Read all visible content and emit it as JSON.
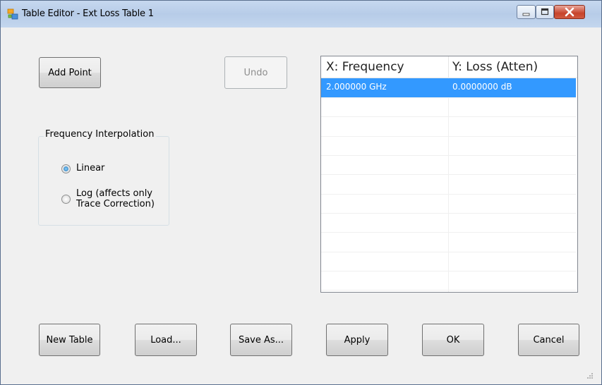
{
  "window": {
    "title": "Table Editor - Ext Loss Table 1"
  },
  "top_buttons": {
    "add_point": "Add Point",
    "undo": "Undo"
  },
  "interpolation": {
    "legend": "Frequency Interpolation",
    "options": [
      {
        "label": "Linear",
        "checked": true
      },
      {
        "label_line1": "Log (affects only",
        "label_line2": "Trace Correction)",
        "checked": false
      }
    ]
  },
  "table": {
    "headers": [
      "X: Frequency",
      "Y: Loss (Atten)"
    ],
    "rows": [
      {
        "x": "2.000000 GHz",
        "y": "0.0000000 dB",
        "selected": true
      }
    ],
    "selection_color": "#3399ff"
  },
  "bottom_buttons": {
    "new_table": "New Table",
    "load": "Load...",
    "save_as": "Save As...",
    "apply": "Apply",
    "ok": "OK",
    "cancel": "Cancel"
  }
}
